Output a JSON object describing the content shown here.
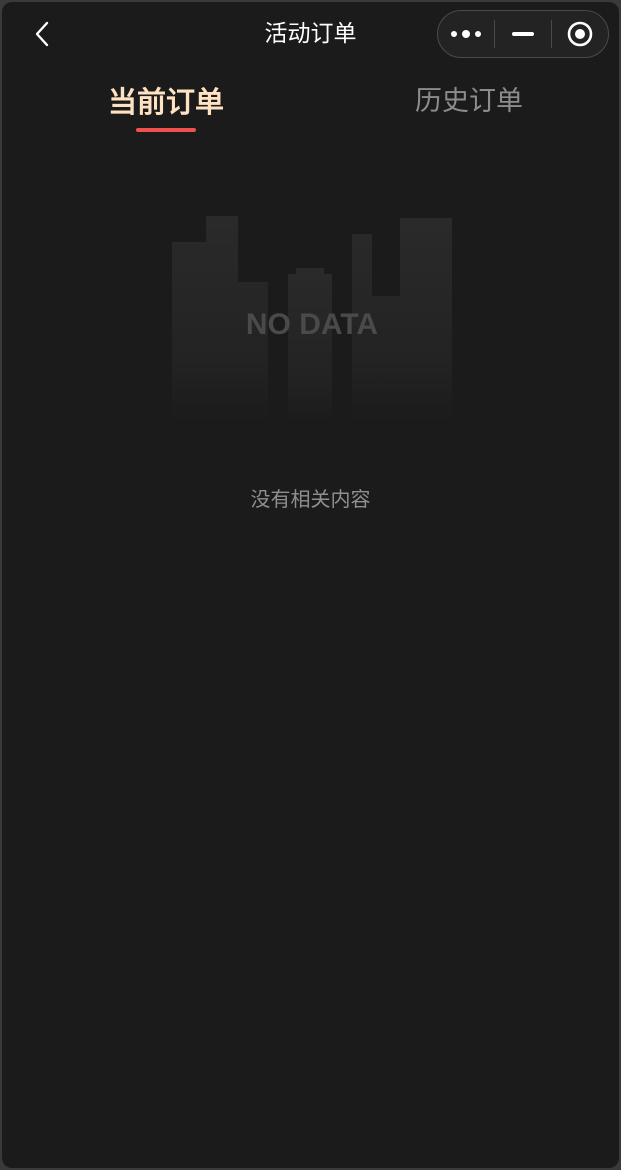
{
  "navbar": {
    "title": "活动订单",
    "back_icon": "chevron-left-icon",
    "capsule": {
      "more_icon": "more-dots-icon",
      "minimize_icon": "minimize-icon",
      "close_icon": "target-circle-icon"
    }
  },
  "tabs": [
    {
      "label": "当前订单",
      "active": true
    },
    {
      "label": "历史订单",
      "active": false
    }
  ],
  "empty_state": {
    "illustration_text": "NO DATA",
    "message": "没有相关内容"
  },
  "colors": {
    "background": "#1b1b1b",
    "active_tab": "#ffe2c2",
    "inactive_tab": "#8c8c8c",
    "indicator": "#f05050",
    "muted_text": "#8f8f8f"
  }
}
